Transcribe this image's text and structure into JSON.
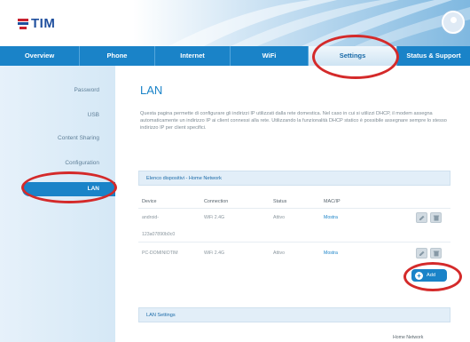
{
  "logo": {
    "text": "TIM"
  },
  "nav": {
    "tabs": [
      {
        "label": "Overview"
      },
      {
        "label": "Phone"
      },
      {
        "label": "Internet"
      },
      {
        "label": "WiFi"
      },
      {
        "label": "Settings"
      },
      {
        "label": "Status & Support"
      }
    ],
    "active": "Settings"
  },
  "sidebar": {
    "items": [
      {
        "label": "Password"
      },
      {
        "label": "USB"
      },
      {
        "label": "Content Sharing"
      },
      {
        "label": "Configuration"
      },
      {
        "label": "LAN"
      }
    ],
    "active": "LAN"
  },
  "main": {
    "title": "LAN",
    "intro": "Questa pagina permette di configurare gli indirizzi IP utilizzati dalla rete domestica. Nel caso in cui si utilizzi DHCP, il modem assegna automaticamente un indirizzo IP ai client connessi alla rete. Utilizzando la funzionalità DHCP statico è possibile assegnare sempre lo stesso indirizzo IP per client specifici.",
    "devices_section": "Elenco dispositivi - Home Network",
    "columns": [
      "Device",
      "Connection",
      "Status",
      "MAC/IP"
    ],
    "rows": [
      {
        "device": "android-",
        "device_line2": "123a07890b0c0",
        "connection": "WiFi 2.4G",
        "status": "Attivo",
        "mac": "Mostra"
      },
      {
        "device": "PC-DOMINIOTIM",
        "connection": "WiFi 2.4G",
        "status": "Attivo",
        "mac": "Mostra"
      }
    ],
    "add_label": "Add",
    "lan_settings_section": "LAN Settings",
    "footer_note": "Home Network"
  },
  "colors": {
    "nav_blue": "#1a83c8",
    "annotation_red": "#d42a2a",
    "brand_red": "#c8202f",
    "brand_blue": "#1f4f9e"
  },
  "icons": [
    "user-icon",
    "edit-icon",
    "delete-icon",
    "plus-icon"
  ]
}
